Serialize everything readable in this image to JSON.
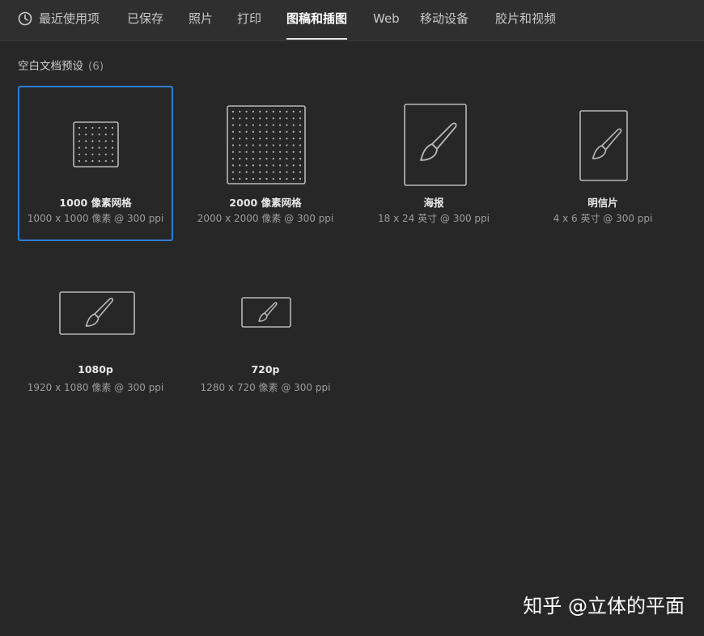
{
  "tabs": [
    {
      "label": "最近使用项",
      "icon": "clock-icon"
    },
    {
      "label": "已保存"
    },
    {
      "label": "照片"
    },
    {
      "label": "打印"
    },
    {
      "label": "图稿和插图",
      "active": true
    },
    {
      "label": "Web"
    },
    {
      "label": "移动设备"
    },
    {
      "label": "胶片和视频"
    }
  ],
  "section": {
    "title": "空白文档预设",
    "count": "(6)"
  },
  "presets": [
    {
      "name": "1000 像素网格",
      "dims": "1000 x 1000 像素 @ 300 ppi",
      "icon": "grid-document-icon",
      "selected": true
    },
    {
      "name": "2000 像素网格",
      "dims": "2000 x 2000 像素 @ 300 ppi",
      "icon": "grid-document-icon"
    },
    {
      "name": "海报",
      "dims": "18 x 24 英寸 @ 300 ppi",
      "icon": "brush-document-icon"
    },
    {
      "name": "明信片",
      "dims": "4 x 6 英寸 @ 300 ppi",
      "icon": "brush-document-icon"
    },
    {
      "name": "1080p",
      "dims": "1920 x 1080 像素 @ 300 ppi",
      "icon": "brush-document-icon"
    },
    {
      "name": "720p",
      "dims": "1280 x 720 像素 @ 300 ppi",
      "icon": "brush-document-icon"
    }
  ],
  "watermark": "知乎 @立体的平面",
  "colors": {
    "background": "#272727",
    "tabbar": "#2f2f2f",
    "selection": "#2f7ed8"
  }
}
